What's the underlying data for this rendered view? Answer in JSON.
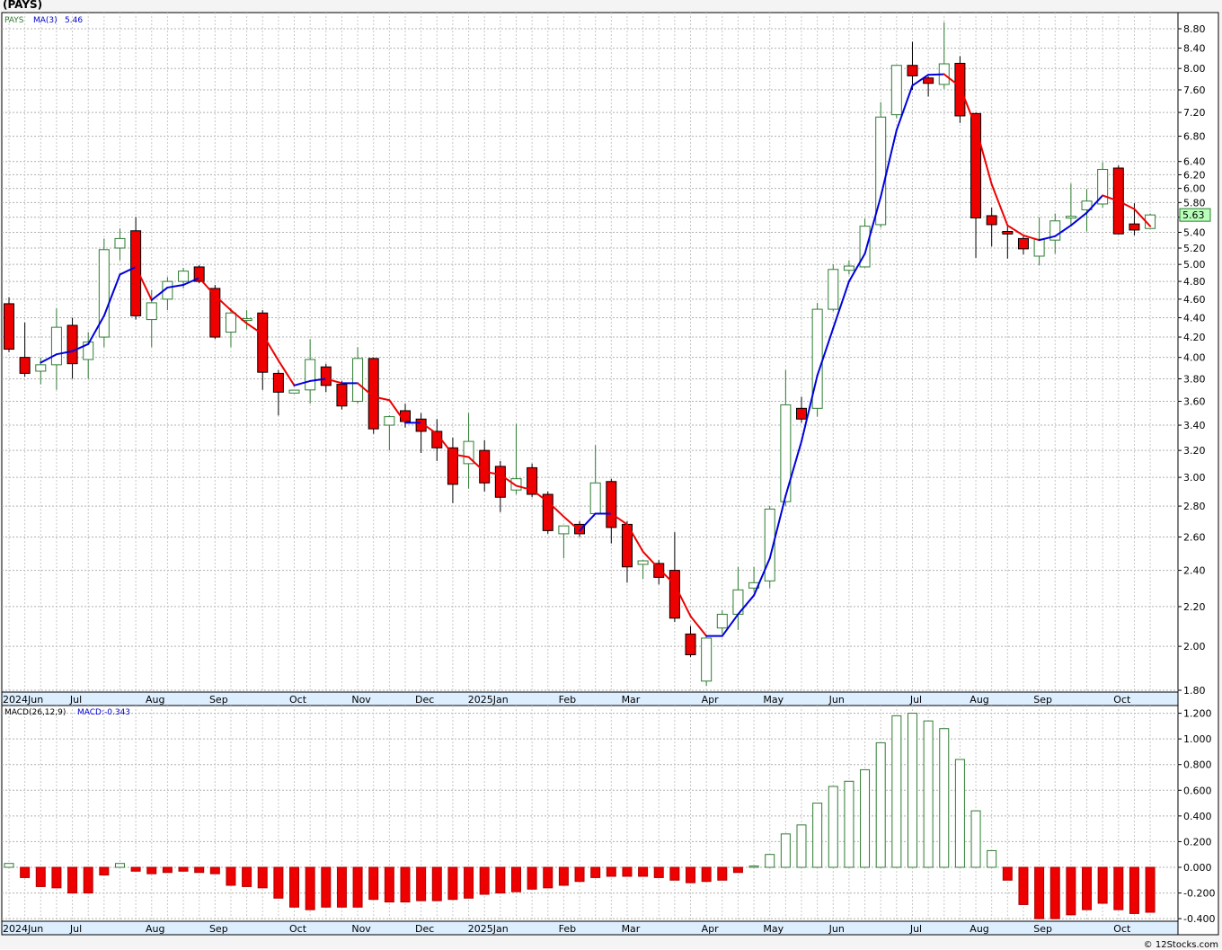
{
  "chart_title": "(PAYS)",
  "credit": "© 12Stocks.com",
  "chart_data": [
    {
      "type": "candlestick",
      "title": "(PAYS)",
      "legend": {
        "ticker": "PAYS",
        "ma_label": "MA(3)",
        "ma_value": "5.46"
      },
      "y_scale": "log",
      "ylim": [
        1.8,
        8.8
      ],
      "y_ticks": [
        "1.80",
        "2.00",
        "2.20",
        "2.40",
        "2.60",
        "2.80",
        "3.00",
        "3.20",
        "3.40",
        "3.60",
        "3.80",
        "4.00",
        "4.20",
        "4.40",
        "4.60",
        "4.80",
        "5.00",
        "5.20",
        "5.40",
        "5.60",
        "5.80",
        "6.00",
        "6.20",
        "6.40",
        "6.80",
        "7.20",
        "7.60",
        "8.00",
        "8.40",
        "8.80"
      ],
      "last_price_label": "5.63",
      "grid": true,
      "colors": {
        "up": "#ffffff",
        "up_outline": "#2e7d32",
        "down": "#ee0000",
        "ma_up": "#0000dd",
        "ma_down": "#ee0000",
        "last_label_bg": "#b9ffb9"
      },
      "x_labels": [
        "2024Jun",
        "Jul",
        "Aug",
        "Sep",
        "Oct",
        "Nov",
        "Dec",
        "2025Jan",
        "Feb",
        "Mar",
        "Apr",
        "May",
        "Jun",
        "Jul",
        "Aug",
        "Sep",
        "Oct"
      ],
      "x_label_weeks": [
        0,
        4,
        9,
        13,
        18,
        22,
        26,
        30,
        35,
        39,
        44,
        48,
        52,
        57,
        61,
        65,
        70
      ],
      "candles_ohlc": [
        [
          4.55,
          4.62,
          4.05,
          4.08
        ],
        [
          4.0,
          4.35,
          3.82,
          3.85
        ],
        [
          3.87,
          4.0,
          3.75,
          3.93
        ],
        [
          3.93,
          4.5,
          3.7,
          4.3
        ],
        [
          4.32,
          4.4,
          3.8,
          3.94
        ],
        [
          3.98,
          4.25,
          3.8,
          4.15
        ],
        [
          4.2,
          5.32,
          4.1,
          5.18
        ],
        [
          5.2,
          5.45,
          5.05,
          5.32
        ],
        [
          5.42,
          5.6,
          4.38,
          4.42
        ],
        [
          4.38,
          4.7,
          4.1,
          4.56
        ],
        [
          4.6,
          4.85,
          4.48,
          4.8
        ],
        [
          4.8,
          4.96,
          4.72,
          4.92
        ],
        [
          4.97,
          4.99,
          4.78,
          4.8
        ],
        [
          4.72,
          4.76,
          4.18,
          4.2
        ],
        [
          4.25,
          4.5,
          4.1,
          4.45
        ],
        [
          4.38,
          4.48,
          4.28,
          4.38
        ],
        [
          4.45,
          4.48,
          3.7,
          3.86
        ],
        [
          3.85,
          3.88,
          3.48,
          3.68
        ],
        [
          3.68,
          3.7,
          3.68,
          3.69
        ],
        [
          3.7,
          4.18,
          3.58,
          3.98
        ],
        [
          3.91,
          3.94,
          3.68,
          3.74
        ],
        [
          3.75,
          3.78,
          3.53,
          3.56
        ],
        [
          3.6,
          4.1,
          3.58,
          3.99
        ],
        [
          3.99,
          4.0,
          3.33,
          3.37
        ],
        [
          3.4,
          3.48,
          3.2,
          3.47
        ],
        [
          3.52,
          3.58,
          3.38,
          3.43
        ],
        [
          3.45,
          3.5,
          3.18,
          3.35
        ],
        [
          3.35,
          3.45,
          3.12,
          3.22
        ],
        [
          3.22,
          3.3,
          2.82,
          2.95
        ],
        [
          3.1,
          3.5,
          2.92,
          3.27
        ],
        [
          3.2,
          3.28,
          2.9,
          2.96
        ],
        [
          3.08,
          3.12,
          2.76,
          2.86
        ],
        [
          2.91,
          3.41,
          2.88,
          2.99
        ],
        [
          3.07,
          3.1,
          2.86,
          2.88
        ],
        [
          2.88,
          2.9,
          2.62,
          2.64
        ],
        [
          2.62,
          2.65,
          2.47,
          2.67
        ],
        [
          2.68,
          2.7,
          2.6,
          2.62
        ],
        [
          2.75,
          3.24,
          2.75,
          2.96
        ],
        [
          2.97,
          2.99,
          2.56,
          2.66
        ],
        [
          2.68,
          2.7,
          2.33,
          2.42
        ],
        [
          2.44,
          2.46,
          2.35,
          2.45
        ],
        [
          2.44,
          2.46,
          2.32,
          2.36
        ],
        [
          2.4,
          2.63,
          2.12,
          2.14
        ],
        [
          2.06,
          2.1,
          1.95,
          1.96
        ],
        [
          1.84,
          2.05,
          1.82,
          2.04
        ],
        [
          2.09,
          2.18,
          2.06,
          2.16
        ],
        [
          2.16,
          2.42,
          2.08,
          2.29
        ],
        [
          2.3,
          2.42,
          2.28,
          2.33
        ],
        [
          2.34,
          2.8,
          2.3,
          2.78
        ],
        [
          2.83,
          3.88,
          2.8,
          3.57
        ],
        [
          3.54,
          3.64,
          3.42,
          3.45
        ],
        [
          3.54,
          4.56,
          3.47,
          4.49
        ],
        [
          4.49,
          5.0,
          4.47,
          4.94
        ],
        [
          4.93,
          5.05,
          4.88,
          4.98
        ],
        [
          4.97,
          5.58,
          4.96,
          5.48
        ],
        [
          5.5,
          7.38,
          5.46,
          7.12
        ],
        [
          7.16,
          8.07,
          7.1,
          8.06
        ],
        [
          8.06,
          8.53,
          7.6,
          7.86
        ],
        [
          7.82,
          7.85,
          7.48,
          7.72
        ],
        [
          7.7,
          8.94,
          7.62,
          8.09
        ],
        [
          8.1,
          8.24,
          7.02,
          7.14
        ],
        [
          7.18,
          7.2,
          5.08,
          5.59
        ],
        [
          5.62,
          5.73,
          5.22,
          5.5
        ],
        [
          5.4,
          5.49,
          5.07,
          5.39
        ],
        [
          5.32,
          5.35,
          5.12,
          5.19
        ],
        [
          5.1,
          5.6,
          4.99,
          5.31
        ],
        [
          5.3,
          5.65,
          5.13,
          5.55
        ],
        [
          5.6,
          6.07,
          5.5,
          5.6
        ],
        [
          5.7,
          5.99,
          5.41,
          5.82
        ],
        [
          5.78,
          6.39,
          5.73,
          6.28
        ],
        [
          6.3,
          6.34,
          5.37,
          5.38
        ],
        [
          5.51,
          5.79,
          5.36,
          5.43
        ],
        [
          5.45,
          5.65,
          5.45,
          5.63
        ]
      ],
      "ma3": [
        null,
        null,
        3.95,
        4.03,
        4.06,
        4.13,
        4.42,
        4.88,
        4.97,
        4.59,
        4.73,
        4.76,
        4.84,
        4.64,
        4.48,
        4.34,
        4.23,
        3.97,
        3.74,
        3.78,
        3.8,
        3.76,
        3.76,
        3.64,
        3.61,
        3.42,
        3.42,
        3.33,
        3.17,
        3.15,
        3.04,
        3.02,
        2.94,
        2.91,
        2.83,
        2.73,
        2.64,
        2.75,
        2.75,
        2.68,
        2.51,
        2.41,
        2.32,
        2.15,
        2.05,
        2.05,
        2.16,
        2.26,
        2.47,
        2.87,
        3.27,
        3.83,
        4.29,
        4.8,
        5.13,
        5.88,
        6.9,
        7.68,
        7.88,
        7.89,
        7.66,
        6.95,
        6.06,
        5.49,
        5.36,
        5.3,
        5.35,
        5.49,
        5.66,
        5.9,
        5.82,
        5.71,
        5.48
      ]
    },
    {
      "type": "bar",
      "title": "MACD(26,12,9)",
      "legend": {
        "label": "MACD(26,12,9)",
        "value_label": "MACD:-0.343"
      },
      "ylim": [
        -0.42,
        1.26
      ],
      "y_ticks": [
        "1.200",
        "1.000",
        "0.800",
        "0.600",
        "0.400",
        "0.200",
        "0.000",
        "-0.200",
        "-0.400"
      ],
      "grid": true,
      "colors": {
        "up": "#ffffff",
        "up_outline": "#2e7d32",
        "down": "#ee0000"
      },
      "values": [
        0.03,
        -0.08,
        -0.15,
        -0.16,
        -0.2,
        -0.2,
        -0.06,
        0.03,
        -0.03,
        -0.05,
        -0.04,
        -0.03,
        -0.04,
        -0.05,
        -0.14,
        -0.15,
        -0.16,
        -0.24,
        -0.31,
        -0.33,
        -0.31,
        -0.31,
        -0.31,
        -0.25,
        -0.27,
        -0.27,
        -0.26,
        -0.26,
        -0.25,
        -0.24,
        -0.21,
        -0.2,
        -0.19,
        -0.17,
        -0.16,
        -0.14,
        -0.11,
        -0.08,
        -0.07,
        -0.07,
        -0.07,
        -0.08,
        -0.1,
        -0.12,
        -0.11,
        -0.1,
        -0.04,
        0.01,
        0.1,
        0.26,
        0.33,
        0.5,
        0.63,
        0.67,
        0.76,
        0.97,
        1.18,
        1.2,
        1.14,
        1.08,
        0.84,
        0.44,
        0.13,
        -0.1,
        -0.29,
        -0.4,
        -0.4,
        -0.37,
        -0.33,
        -0.28,
        -0.33,
        -0.36,
        -0.35
      ]
    }
  ]
}
